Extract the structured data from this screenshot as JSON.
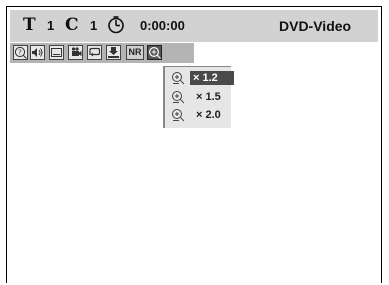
{
  "status_bar": {
    "title_letter": "T",
    "title_number": "1",
    "chapter_letter": "C",
    "chapter_number": "1",
    "time": "0:00:00",
    "disc_type": "DVD-Video"
  },
  "icon_bar": {
    "icons": [
      "help-icon",
      "audio-icon",
      "subtitle-icon",
      "angle-icon",
      "repeat-icon",
      "marker-icon",
      "nr-icon",
      "zoom-icon"
    ],
    "nr_label": "NR"
  },
  "zoom_menu": {
    "options": [
      "× 1.2",
      "× 1.5",
      "× 2.0"
    ],
    "selected": "× 1.2"
  }
}
